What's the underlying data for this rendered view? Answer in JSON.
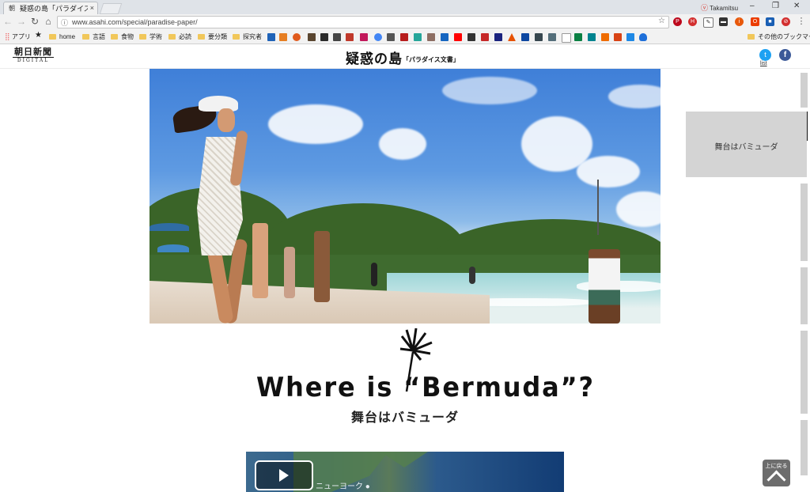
{
  "browser": {
    "tab_favicon": "朝",
    "tab_title": "疑惑の島「パラダイス文書」",
    "tab_close": "×",
    "profile_name": "Takamitsu",
    "url": "www.asahi.com/special/paradise-paper/",
    "window_minimize": "–",
    "window_restore": "❐",
    "window_close": "✕"
  },
  "bookmarks": {
    "apps_label": "アプリ",
    "items": [
      "home",
      "言語",
      "食物",
      "学術",
      "必読",
      "要分類",
      "探究者"
    ],
    "other_label": "その他のブックマーク"
  },
  "site": {
    "logo_top": "朝日新聞",
    "logo_bottom": "DIGITAL",
    "title_main": "疑惑の島",
    "title_sub": "「パラダイス文書」",
    "twitter_label": "list"
  },
  "main": {
    "headline": "Where is “Bermuda”?",
    "subheadline": "舞台はバミューダ",
    "video_label": "ニューヨーク ●"
  },
  "side_nav": {
    "active_chapter": "舞台はバミューダ"
  },
  "back_to_top": {
    "label": "上に戻る"
  }
}
